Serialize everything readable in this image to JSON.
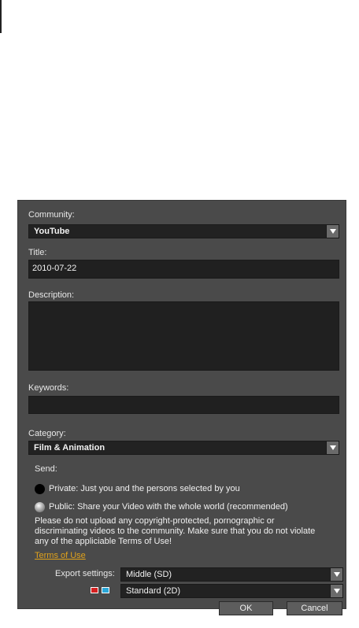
{
  "dialog": {
    "community_label": "Community:",
    "community_value": "YouTube",
    "title_label": "Title:",
    "title_value": "2010-07-22",
    "description_label": "Description:",
    "description_value": "",
    "keywords_label": "Keywords:",
    "keywords_value": "",
    "category_label": "Category:",
    "category_value": "Film & Animation",
    "send_label": "Send:",
    "private_option": "Private: Just you and the persons selected by you",
    "public_option": "Public: Share your Video with the whole world (recommended)",
    "selected_option": "private",
    "notice": "Please do not upload any copyright-protected, pornographic or discriminating videos to the community. Make sure that you do not violate any of the appliciable Terms of Use!",
    "terms_link": "Terms of Use",
    "export_label": "Export settings:",
    "export_value": "Middle (SD)",
    "stereo_value": "Standard (2D)",
    "ok_label": "OK",
    "cancel_label": "Cancel"
  },
  "colors": {
    "panel": "#4a4a4a",
    "field": "#222222",
    "link": "#e0a21b",
    "glasses_left": "#d42020",
    "glasses_right": "#2aa7d8"
  },
  "icons": {
    "dropdown": "chevron-down-icon",
    "stereo": "3d-glasses-icon"
  }
}
